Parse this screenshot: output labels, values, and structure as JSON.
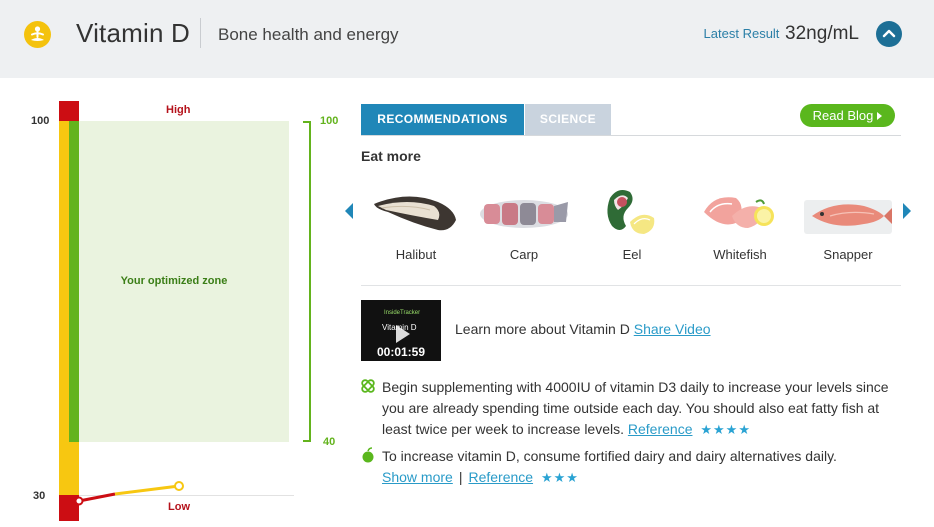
{
  "header": {
    "title": "Vitamin D",
    "subtitle": "Bone health and energy",
    "latest_label": "Latest Result",
    "latest_value": "32ng/mL",
    "icon": "meditation-icon",
    "collapse_icon": "chevron-up-icon"
  },
  "gauge": {
    "scale_top": "100",
    "scale_bottom": "30",
    "high_label": "High",
    "low_label": "Low",
    "zone_label": "Your optimized zone",
    "zone_top": "100",
    "zone_bottom": "40",
    "colors": {
      "red": "#cc0d13",
      "yellow": "#f7c711",
      "green": "#63b31d",
      "zone": "#eaf3df"
    }
  },
  "tabs": [
    {
      "label": "RECOMMENDATIONS",
      "active": true
    },
    {
      "label": "SCIENCE",
      "active": false
    }
  ],
  "blog_button": "Read Blog",
  "eat_more": {
    "heading": "Eat more",
    "foods": [
      {
        "name": "Halibut"
      },
      {
        "name": "Carp"
      },
      {
        "name": "Eel"
      },
      {
        "name": "Whitefish"
      },
      {
        "name": "Snapper"
      }
    ]
  },
  "video": {
    "brand": "InsideTracker",
    "title": "Vitamin D",
    "duration": "00:01:59",
    "description": "Learn more about Vitamin D",
    "share_label": "Share Video"
  },
  "recommendations": [
    {
      "icon": "supplement-icon",
      "text": "Begin supplementing with 4000IU of vitamin D3 daily to increase your levels since you are already spending time outside each day. You should also eat fatty fish at least twice per week to increase levels.",
      "reference_label": "Reference",
      "stars": "★★★★"
    },
    {
      "icon": "apple-icon",
      "text": "To increase vitamin D, consume fortified dairy and dairy alternatives daily.",
      "show_more_label": "Show more",
      "separator": "|",
      "reference_label": "Reference",
      "stars": "★★★"
    }
  ],
  "accent_color": "#2087b8"
}
